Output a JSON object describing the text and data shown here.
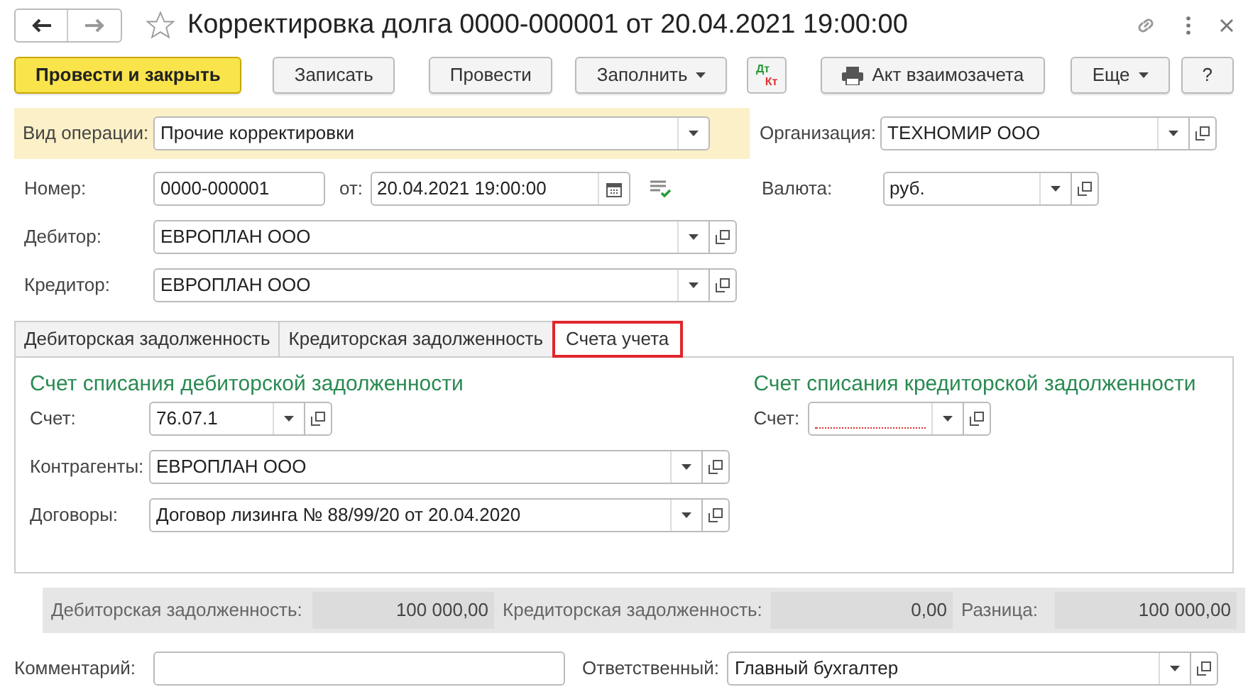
{
  "title": "Корректировка долга 0000-000001 от 20.04.2021 19:00:00",
  "favorite": false,
  "toolbar": [
    {
      "kind": "primary",
      "label": "Провести и закрыть"
    },
    {
      "kind": "plain",
      "label": "Записать"
    },
    {
      "kind": "plain",
      "label": "Провести"
    },
    {
      "kind": "menu",
      "label": "Заполнить"
    },
    {
      "kind": "dtkt",
      "label_top": "Дт",
      "label_bottom": "Кт"
    },
    {
      "kind": "print",
      "label": "Акт взаимозачета"
    },
    {
      "kind": "spacer"
    },
    {
      "kind": "menu",
      "label": "Еще"
    },
    {
      "kind": "plain",
      "label": "?"
    }
  ],
  "operation": {
    "label": "Вид операции:",
    "value": "Прочие корректировки"
  },
  "organization": {
    "label": "Организация:",
    "value": "ТЕХНОМИР ООО"
  },
  "number": {
    "label": "Номер:",
    "value": "0000-000001"
  },
  "date": {
    "label": "от:",
    "value": "20.04.2021 19:00:00"
  },
  "currency": {
    "label": "Валюта:",
    "value": "руб."
  },
  "debtor": {
    "label": "Дебитор:",
    "value": "ЕВРОПЛАН ООО"
  },
  "creditor": {
    "label": "Кредитор:",
    "value": "ЕВРОПЛАН ООО"
  },
  "tabs": [
    {
      "label": "Дебиторская задолженность",
      "selected": false,
      "highlighted": false
    },
    {
      "label": "Кредиторская задолженность",
      "selected": false,
      "highlighted": false
    },
    {
      "label": "Счета учета",
      "selected": true,
      "highlighted": true
    }
  ],
  "left_section": {
    "heading": "Счет списания дебиторской задолженности",
    "fields": [
      {
        "label": "Счет:",
        "value": "76.07.1",
        "short": true,
        "required_empty": false
      },
      {
        "label": "Контрагенты:",
        "value": "ЕВРОПЛАН ООО",
        "short": false,
        "required_empty": false
      },
      {
        "label": "Договоры:",
        "value": "Договор лизинга № 88/99/20 от 20.04.2020",
        "short": false,
        "required_empty": false
      }
    ]
  },
  "right_section": {
    "heading": "Счет списания кредиторской задолженности",
    "fields": [
      {
        "label": "Счет:",
        "short": true,
        "required_empty": true
      }
    ]
  },
  "totals": [
    {
      "label": "Дебиторская задолженность:",
      "value": "100 000,00"
    },
    {
      "label": "Кредиторская задолженность:",
      "value": "0,00"
    },
    {
      "label": "Разница:",
      "value": "100 000,00"
    }
  ],
  "comment": {
    "label": "Комментарий:"
  },
  "responsible": {
    "label": "Ответственный:",
    "value": "Главный бухгалтер"
  }
}
